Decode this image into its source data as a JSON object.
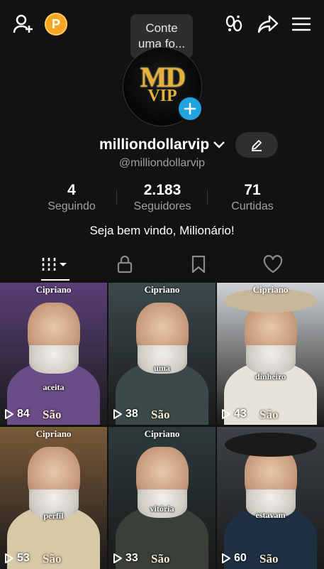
{
  "header": {
    "tooltip_line1": "Conte",
    "tooltip_line2": "uma fo...",
    "coin_label": "P"
  },
  "profile": {
    "avatar_text_line1": "MD",
    "avatar_text_line2": "VIP",
    "username": "milliondollarvip",
    "handle": "@milliondollarvip",
    "bio": "Seja bem vindo, Milionário!"
  },
  "stats": [
    {
      "value": "4",
      "label": "Seguindo"
    },
    {
      "value": "2.183",
      "label": "Seguidores"
    },
    {
      "value": "71",
      "label": "Curtidas"
    }
  ],
  "videos": [
    {
      "views": "84",
      "top_text": "Cipriano",
      "caption": "aceita",
      "bottom_text": "São",
      "bg": "#5a3f78",
      "robe": "#6a4c86"
    },
    {
      "views": "38",
      "top_text": "Cipriano",
      "caption": "uma",
      "bottom_text": "São",
      "bg": "#3c4a4e",
      "robe": "#3b4a48"
    },
    {
      "views": "43",
      "top_text": "Cipriano",
      "caption": "dinheiro",
      "bottom_text": "São",
      "bg": "#cfd3d6",
      "robe": "#e7e2d8"
    },
    {
      "views": "53",
      "top_text": "Cipriano",
      "caption": "perfil",
      "bottom_text": "São",
      "bg": "#7a5a38",
      "robe": "#d8c8a8"
    },
    {
      "views": "33",
      "top_text": "Cipriano",
      "caption": "vitória",
      "bottom_text": "São",
      "bg": "#2c3a3c",
      "robe": "#3a4038"
    },
    {
      "views": "60",
      "top_text": "",
      "caption": "estavam",
      "bottom_text": "São",
      "bg": "#3c4248",
      "robe": "#1e3042"
    }
  ]
}
